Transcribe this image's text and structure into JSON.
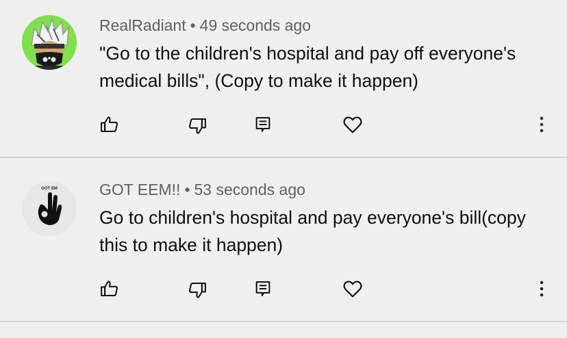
{
  "comments": [
    {
      "author": "RealRadiant",
      "separator": "•",
      "time": "49 seconds ago",
      "text": "\"Go to the children's hospital and pay off everyone's medical bills\", (Copy to make it happen)",
      "avatar_icon": "masked-character-avatar",
      "avatar_bg": "#7fe04a"
    },
    {
      "author": "GOT EEM!!",
      "separator": "•",
      "time": "53 seconds ago",
      "text": "Go to children's hospital and pay everyone's bill(copy this to make it happen)",
      "avatar_icon": "ok-hand-avatar",
      "avatar_caption": "GOT EM",
      "avatar_bg": "#e8e8e8"
    }
  ],
  "actions": {
    "like_icon": "thumbs-up-icon",
    "dislike_icon": "thumbs-down-icon",
    "reply_icon": "reply-icon",
    "heart_icon": "heart-icon",
    "more_icon": "more-vertical-icon"
  },
  "colors": {
    "background": "#f0f0f0",
    "meta_text": "#606060",
    "body_text": "#0f0f0f",
    "divider": "#d6d6d6"
  }
}
